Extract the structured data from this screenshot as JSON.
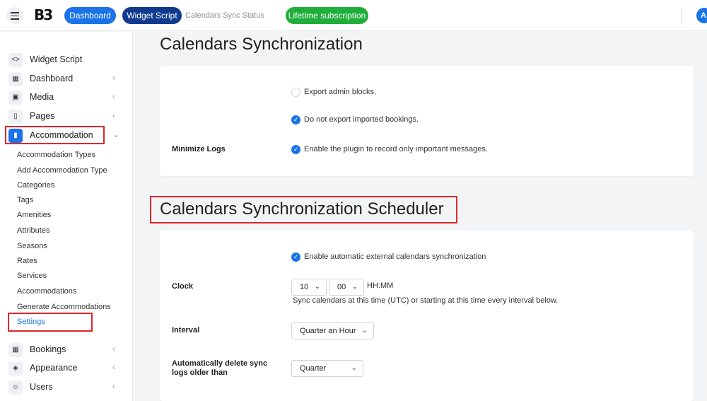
{
  "topbar": {
    "logo": "B",
    "dashboard_label": "Dashboard",
    "widget_label": "Widget Script",
    "breadcrumb": "Calendars Sync Status",
    "lifetime_label": "Lifetime subscription",
    "avatar_initial": "A"
  },
  "sidebar": {
    "items": [
      {
        "label": "Widget Script",
        "icon": "code-icon"
      },
      {
        "label": "Dashboard",
        "icon": "grid-icon"
      },
      {
        "label": "Media",
        "icon": "image-icon"
      },
      {
        "label": "Pages",
        "icon": "pages-icon"
      },
      {
        "label": "Accommodation",
        "icon": "building-icon"
      }
    ],
    "sub_items": [
      "Accommodation Types",
      "Add Accommodation Type",
      "Categories",
      "Tags",
      "Amenities",
      "Attributes",
      "Seasons",
      "Rates",
      "Services",
      "Accommodations",
      "Generate Accommodations",
      "Settings"
    ],
    "bottom_items": [
      {
        "label": "Bookings",
        "icon": "calendar-icon"
      },
      {
        "label": "Appearance",
        "icon": "paint-bucket-icon"
      },
      {
        "label": "Users",
        "icon": "users-icon"
      }
    ]
  },
  "sync": {
    "title": "Calendars Synchronization",
    "export_admin": "Export admin blocks.",
    "no_export_imported": "Do not export imported bookings.",
    "minimize_logs_label": "Minimize Logs",
    "minimize_logs_text": "Enable the plugin to record only important messages."
  },
  "scheduler": {
    "title": "Calendars Synchronization Scheduler",
    "enable_text": "Enable automatic external calendars synchronization",
    "clock_label": "Clock",
    "hour": "10",
    "minute": "00",
    "time_format": "HH:MM",
    "clock_help": "Sync calendars at this time (UTC) or starting at this time every interval below.",
    "interval_label": "Interval",
    "interval_value": "Quarter an Hour",
    "delete_label": "Automatically delete sync logs older than",
    "delete_value": "Quarter"
  },
  "colors": {
    "primary": "#1a73e8",
    "dark_blue": "#0f3a8f",
    "green": "#1fae3b",
    "highlight": "#e0262b"
  }
}
